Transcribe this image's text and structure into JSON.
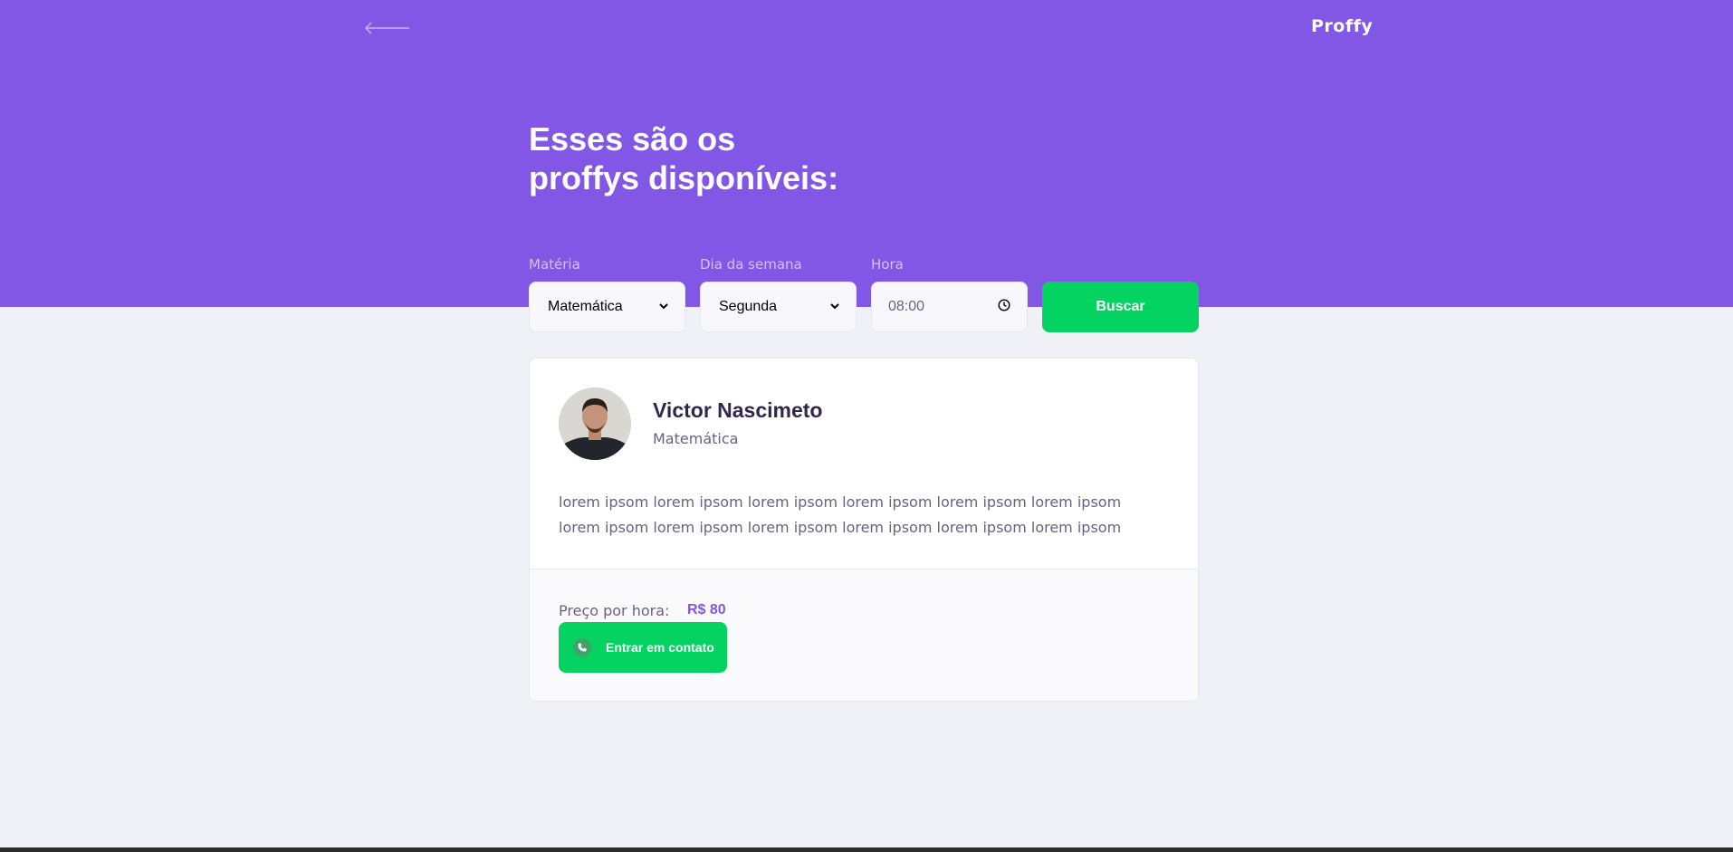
{
  "header": {
    "back_icon": "arrow-left-icon",
    "logo_text": "Proffy"
  },
  "title": {
    "line1": "Esses são os",
    "line2": "proffys disponíveis:"
  },
  "search_form": {
    "subject_label": "Matéria",
    "subject_value": "Matemática",
    "weekday_label": "Dia da semana",
    "weekday_value": "Segunda",
    "time_label": "Hora",
    "time_value": "08:00",
    "submit_label": "Buscar"
  },
  "teachers": [
    {
      "name": "Victor Nascimeto",
      "subject": "Matemática",
      "bio": "lorem ipsom lorem ipsom lorem ipsom lorem ipsom lorem ipsom lorem ipsom lorem ipsom lorem ipsom lorem ipsom lorem ipsom lorem ipsom lorem ipsom",
      "price_label": "Preço por hora:",
      "price_value": "R$ 80",
      "contact_label": "Entrar em contato",
      "contact_icon": "whatsapp-icon"
    }
  ],
  "colors": {
    "primary": "#8257e5",
    "secondary": "#04d361",
    "background": "#f0f0f7",
    "title_text": "#32264d",
    "body_text": "#6a6180"
  }
}
